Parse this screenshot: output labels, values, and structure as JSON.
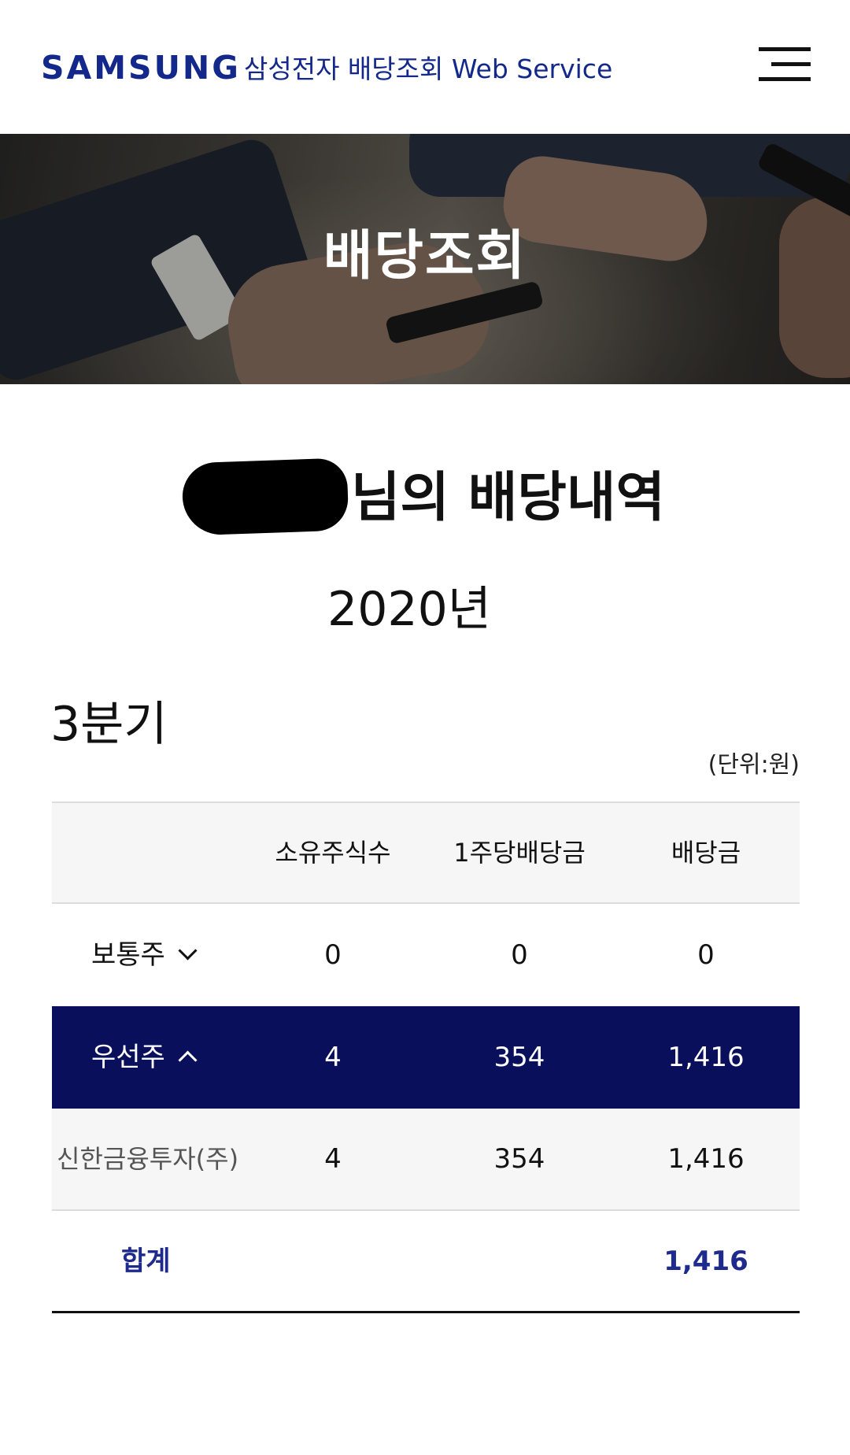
{
  "header": {
    "logo_text": "SAMSUNG",
    "service_title": "삼성전자 배당조회 Web Service",
    "menu_icon": "hamburger-menu-icon"
  },
  "hero": {
    "title": "배당조회"
  },
  "summary": {
    "heading": "님의 배당내역",
    "year": "2020년",
    "quarter": "3분기",
    "unit": "(단위:원)"
  },
  "table": {
    "columns": [
      "",
      "소유주식수",
      "1주당배당금",
      "배당금"
    ],
    "common": {
      "label": "보통주",
      "expand_icon": "chevron-down-icon",
      "shares": "0",
      "per_share": "0",
      "dividend": "0"
    },
    "preferred": {
      "label": "우선주",
      "expand_icon": "chevron-up-icon",
      "shares": "4",
      "per_share": "354",
      "dividend": "1,416"
    },
    "broker": {
      "label": "신한금융투자(주)",
      "shares": "4",
      "per_share": "354",
      "dividend": "1,416"
    },
    "total": {
      "label": "합계",
      "dividend": "1,416"
    }
  },
  "colors": {
    "brand": "#14288c",
    "highlight_row": "#0a0f5c",
    "total_text": "#1e2a8c"
  }
}
